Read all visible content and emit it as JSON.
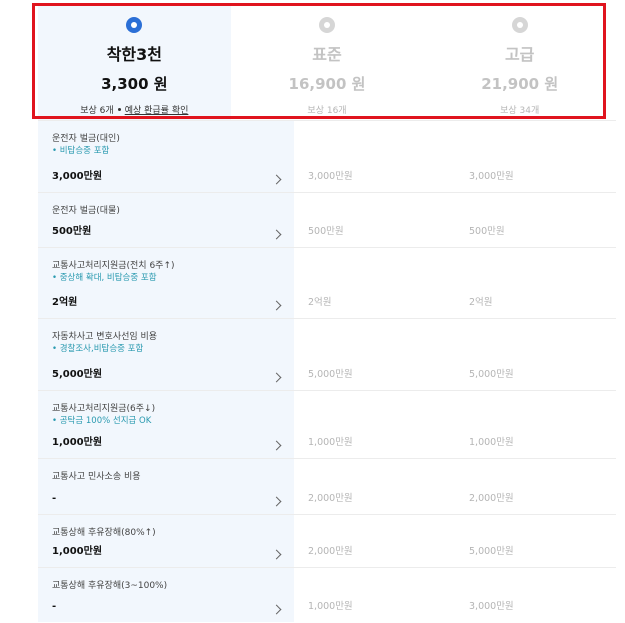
{
  "plans": [
    {
      "name": "착한3천",
      "price": "3,300 원",
      "meta": "보상 6개",
      "link": "예상 환급률 확인",
      "selected": true
    },
    {
      "name": "표준",
      "price": "16,900 원",
      "meta": "보상 16개",
      "selected": false
    },
    {
      "name": "고급",
      "price": "21,900 원",
      "meta": "보상 34개",
      "selected": false
    }
  ],
  "rows": [
    {
      "label": "운전자 벌금(대인)",
      "sub": "• 비탑승중 포함",
      "v1": "3,000만원",
      "v2": "3,000만원",
      "v3": "3,000만원"
    },
    {
      "label": "운전자 벌금(대물)",
      "sub": "",
      "v1": "500만원",
      "v2": "500만원",
      "v3": "500만원"
    },
    {
      "label": "교통사고처리지원금(전치 6주↑)",
      "sub": "• 중상해 확대, 비탑승중 포함",
      "v1": "2억원",
      "v2": "2억원",
      "v3": "2억원"
    },
    {
      "label": "자동차사고 변호사선임 비용",
      "sub": "• 경찰조사,비탑승중 포함",
      "v1": "5,000만원",
      "v2": "5,000만원",
      "v3": "5,000만원"
    },
    {
      "label": "교통사고처리지원금(6주↓)",
      "sub": "• 공탁금 100% 선지급 OK",
      "v1": "1,000만원",
      "v2": "1,000만원",
      "v3": "1,000만원"
    },
    {
      "label": "교통사고 민사소송 비용",
      "sub": "",
      "v1": "-",
      "v2": "2,000만원",
      "v3": "2,000만원"
    },
    {
      "label": "교통상해 후유장해(80%↑)",
      "sub": "",
      "v1": "1,000만원",
      "v2": "2,000만원",
      "v3": "5,000만원"
    },
    {
      "label": "교통상해 후유장해(3~100%)",
      "sub": "",
      "v1": "-",
      "v2": "1,000만원",
      "v3": "3,000만원"
    }
  ]
}
